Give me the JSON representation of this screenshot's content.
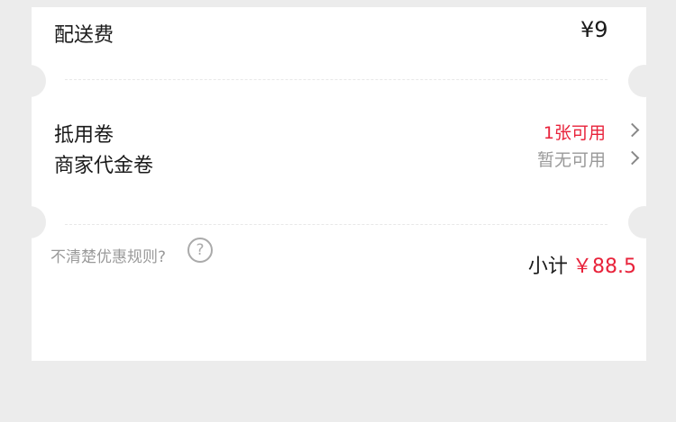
{
  "delivery": {
    "label": "配送费",
    "value": "¥9"
  },
  "coupons": {
    "voucher": {
      "label": "抵用卷",
      "status": "1张可用"
    },
    "merchant": {
      "label": "商家代金卷",
      "status": "暂无可用"
    }
  },
  "footer": {
    "help_text": "不清楚优惠规则?",
    "help_icon": "?",
    "subtotal_label": "小计",
    "subtotal_value": "￥88.5"
  },
  "colors": {
    "accent": "#e8223a",
    "muted": "#999999",
    "background": "#ececec"
  }
}
